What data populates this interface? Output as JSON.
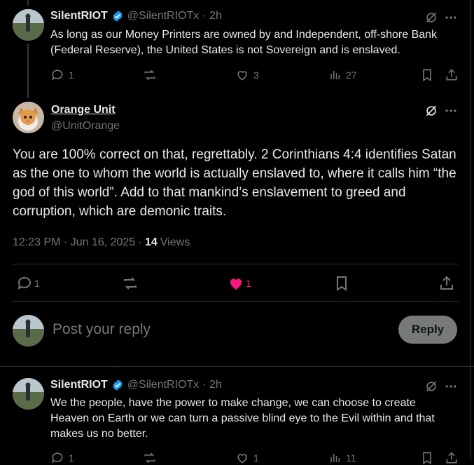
{
  "post1": {
    "author": "SilentRIOT",
    "handle": "@SilentRIOTx",
    "time": "· 2h",
    "text": "As long as our Money Printers are owned by and Independent, off-shore Bank (Federal Reserve), the United States is not Sovereign and is enslaved.",
    "replies": "1",
    "likes": "3",
    "views": "27"
  },
  "main": {
    "author": "Orange Unit",
    "handle": "@UnitOrange",
    "text": "You are 100% correct on that, regrettably.  2 Corinthians 4:4 identifies Satan as the one to whom the world is actually enslaved to, where it calls him “the god of this world”. Add to that mankind’s enslavement to greed and corruption, which are demonic traits.",
    "timestamp": "12:23 PM · Jun 16, 2025 ·",
    "views_count": "14",
    "views_label": "Views",
    "replies": "1",
    "likes": "1"
  },
  "composer": {
    "placeholder": "Post your reply",
    "button": "Reply"
  },
  "post2": {
    "author": "SilentRIOT",
    "handle": "@SilentRIOTx",
    "time": "· 2h",
    "text": "We the people, have the power to make change, we can choose to create Heaven on Earth or we can turn a passive blind eye to the Evil within and that makes us no better.",
    "replies": "1",
    "likes": "1",
    "views": "11"
  },
  "colors": {
    "like_active": "#f91880",
    "verified": "#1d9bf0",
    "muted": "#71767b"
  }
}
